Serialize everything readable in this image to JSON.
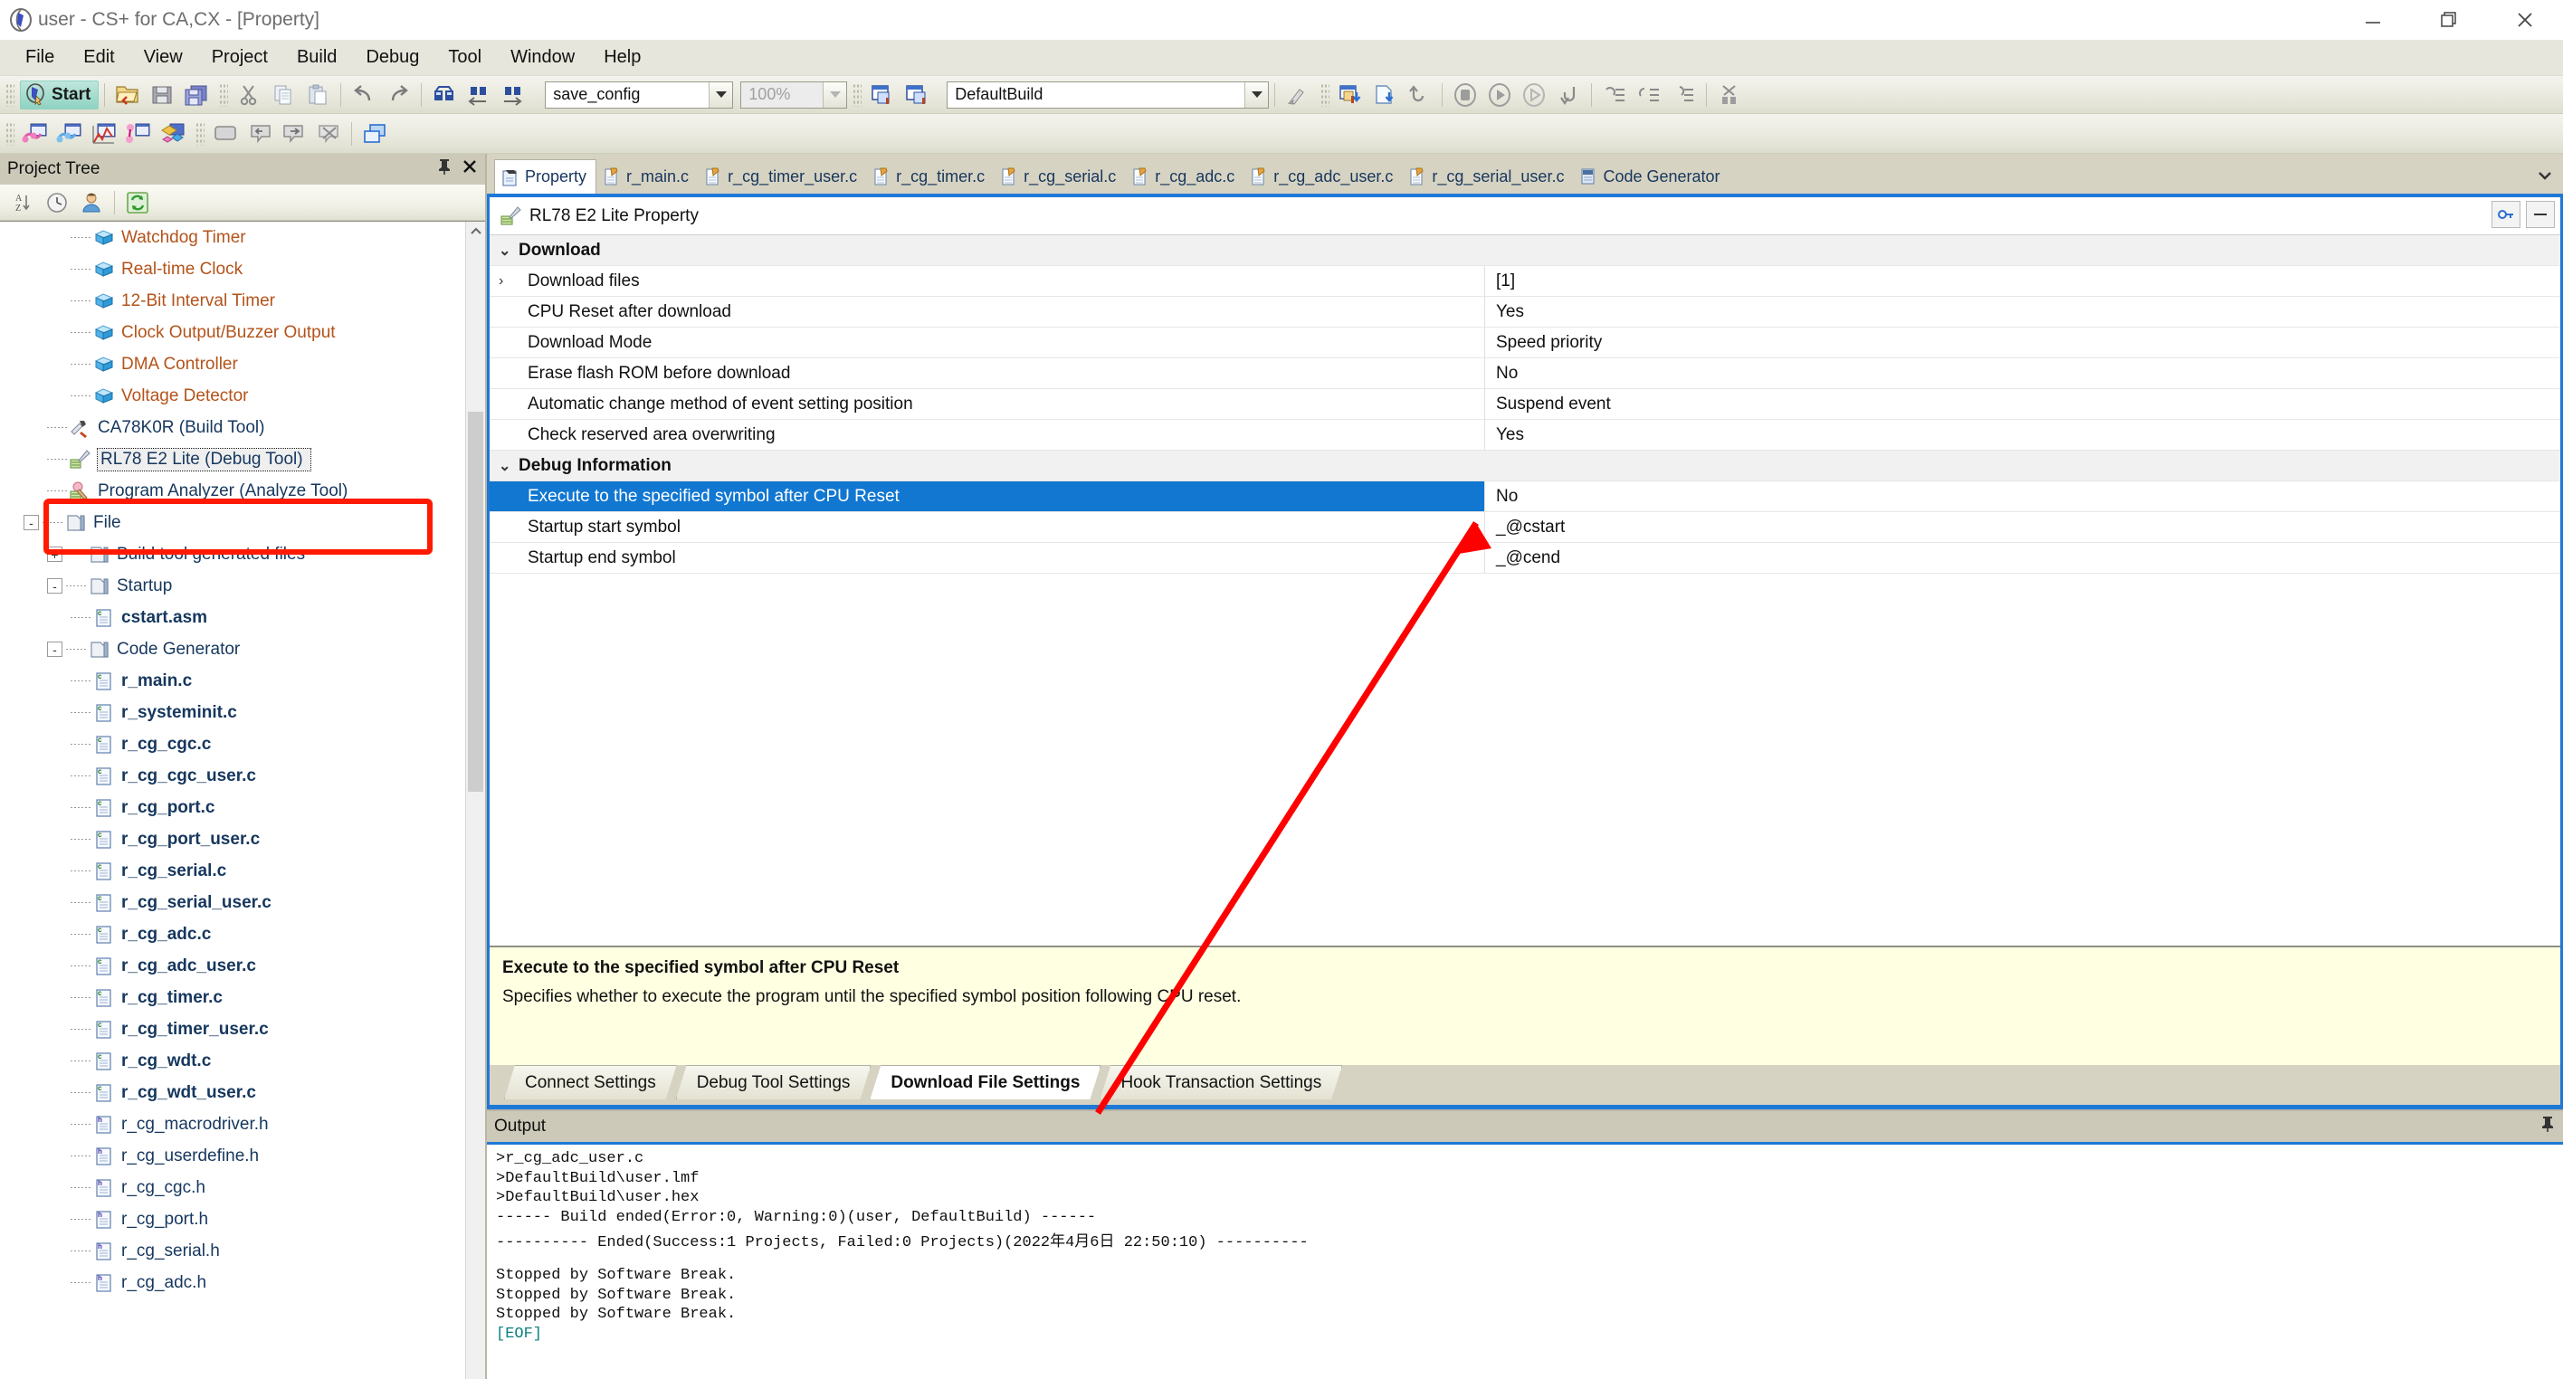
{
  "window": {
    "title": "user - CS+ for CA,CX - [Property]",
    "app_icon": "cs-plus-icon",
    "controls": {
      "minimize": "minimize-icon",
      "restore": "restore-icon",
      "close": "close-icon"
    }
  },
  "menubar": {
    "items": [
      "File",
      "Edit",
      "View",
      "Project",
      "Build",
      "Debug",
      "Tool",
      "Window",
      "Help"
    ]
  },
  "toolbar": {
    "start_label": "Start",
    "build_config": "save_config",
    "zoom_level": "100%",
    "build_mode": "DefaultBuild",
    "icons": [
      "open-folder-icon",
      "save-icon",
      "save-all-icon",
      "cut-icon",
      "copy-icon",
      "paste-icon",
      "undo-icon",
      "redo-icon",
      "find-in-files-icon",
      "find-previous-icon",
      "find-next-icon",
      "build-project-icon",
      "rebuild-project-icon",
      "clean-icon",
      "download-icon",
      "build-and-download-icon",
      "restart-icon",
      "stop-icon",
      "run-icon",
      "step-over-icon",
      "step-return-icon",
      "step-into-icon",
      "step-out-icon",
      "step-cursor-icon",
      "disconnect-icon"
    ],
    "row2_icons": [
      "cpu-register-icon",
      "memory-icon",
      "analyze-chart-icon",
      "pin-tool-icon",
      "event-icon",
      "rect-select-icon",
      "callout-left-icon",
      "callout-right-icon",
      "no-callout-icon",
      "cascade-windows-icon"
    ]
  },
  "project_tree": {
    "title": "Project Tree",
    "header_icons": [
      "pin-icon",
      "close-icon"
    ],
    "toolbar_icons": [
      "sort-az-icon",
      "history-icon",
      "user-icon",
      "refresh-icon"
    ],
    "nodes": [
      {
        "label": "Watchdog Timer",
        "icon": "peripheral-cube-icon",
        "depth": 3,
        "kind": "peripheral"
      },
      {
        "label": "Real-time Clock",
        "icon": "peripheral-cube-icon",
        "depth": 3,
        "kind": "peripheral"
      },
      {
        "label": "12-Bit Interval Timer",
        "icon": "peripheral-cube-icon",
        "depth": 3,
        "kind": "peripheral"
      },
      {
        "label": "Clock Output/Buzzer Output",
        "icon": "peripheral-cube-icon",
        "depth": 3,
        "kind": "peripheral"
      },
      {
        "label": "DMA Controller",
        "icon": "peripheral-cube-icon",
        "depth": 3,
        "kind": "peripheral"
      },
      {
        "label": "Voltage Detector",
        "icon": "peripheral-cube-icon",
        "depth": 3,
        "kind": "peripheral"
      },
      {
        "label": "CA78K0R (Build Tool)",
        "icon": "build-tool-icon",
        "depth": 2,
        "kind": "tool-blue"
      },
      {
        "label": "RL78 E2 Lite (Debug Tool)",
        "icon": "debug-tool-icon",
        "depth": 2,
        "kind": "tool-selected"
      },
      {
        "label": "Program Analyzer (Analyze Tool)",
        "icon": "analyze-tool-icon",
        "depth": 2,
        "kind": "tool"
      },
      {
        "label": "File",
        "icon": "folder-file-icon",
        "depth": 1,
        "kind": "folder",
        "expander": "-"
      },
      {
        "label": "Build tool generated files",
        "icon": "generated-folder-icon",
        "depth": 2,
        "kind": "folder",
        "expander": "+"
      },
      {
        "label": "Startup",
        "icon": "startup-folder-icon",
        "depth": 2,
        "kind": "folder",
        "expander": "-"
      },
      {
        "label": "cstart.asm",
        "icon": "asm-file-icon",
        "depth": 3,
        "kind": "file-bold"
      },
      {
        "label": "Code Generator",
        "icon": "folder-icon",
        "depth": 2,
        "kind": "folder",
        "expander": "-"
      },
      {
        "label": "r_main.c",
        "icon": "c-file-icon",
        "depth": 3,
        "kind": "file-bold"
      },
      {
        "label": "r_systeminit.c",
        "icon": "c-file-icon",
        "depth": 3,
        "kind": "file-bold"
      },
      {
        "label": "r_cg_cgc.c",
        "icon": "c-file-icon",
        "depth": 3,
        "kind": "file-bold"
      },
      {
        "label": "r_cg_cgc_user.c",
        "icon": "c-file-icon",
        "depth": 3,
        "kind": "file-bold"
      },
      {
        "label": "r_cg_port.c",
        "icon": "c-file-icon",
        "depth": 3,
        "kind": "file-bold"
      },
      {
        "label": "r_cg_port_user.c",
        "icon": "c-file-icon",
        "depth": 3,
        "kind": "file-bold"
      },
      {
        "label": "r_cg_serial.c",
        "icon": "c-file-icon",
        "depth": 3,
        "kind": "file-bold"
      },
      {
        "label": "r_cg_serial_user.c",
        "icon": "c-file-icon",
        "depth": 3,
        "kind": "file-bold"
      },
      {
        "label": "r_cg_adc.c",
        "icon": "c-file-icon",
        "depth": 3,
        "kind": "file-bold"
      },
      {
        "label": "r_cg_adc_user.c",
        "icon": "c-file-icon",
        "depth": 3,
        "kind": "file-bold"
      },
      {
        "label": "r_cg_timer.c",
        "icon": "c-file-icon",
        "depth": 3,
        "kind": "file-bold"
      },
      {
        "label": "r_cg_timer_user.c",
        "icon": "c-file-icon",
        "depth": 3,
        "kind": "file-bold"
      },
      {
        "label": "r_cg_wdt.c",
        "icon": "c-file-icon",
        "depth": 3,
        "kind": "file-bold"
      },
      {
        "label": "r_cg_wdt_user.c",
        "icon": "c-file-icon",
        "depth": 3,
        "kind": "file-bold"
      },
      {
        "label": "r_cg_macrodriver.h",
        "icon": "h-file-icon",
        "depth": 3,
        "kind": "file"
      },
      {
        "label": "r_cg_userdefine.h",
        "icon": "h-file-icon",
        "depth": 3,
        "kind": "file"
      },
      {
        "label": "r_cg_cgc.h",
        "icon": "h-file-icon",
        "depth": 3,
        "kind": "file"
      },
      {
        "label": "r_cg_port.h",
        "icon": "h-file-icon",
        "depth": 3,
        "kind": "file"
      },
      {
        "label": "r_cg_serial.h",
        "icon": "h-file-icon",
        "depth": 3,
        "kind": "file"
      },
      {
        "label": "r_cg_adc.h",
        "icon": "h-file-icon",
        "depth": 3,
        "kind": "file"
      }
    ]
  },
  "editor_tabs": {
    "items": [
      {
        "label": "Property",
        "icon": "property-icon",
        "active": true
      },
      {
        "label": "r_main.c",
        "icon": "c-source-icon",
        "active": false
      },
      {
        "label": "r_cg_timer_user.c",
        "icon": "c-source-icon",
        "active": false
      },
      {
        "label": "r_cg_timer.c",
        "icon": "c-source-icon",
        "active": false
      },
      {
        "label": "r_cg_serial.c",
        "icon": "c-source-icon",
        "active": false
      },
      {
        "label": "r_cg_adc.c",
        "icon": "c-source-icon",
        "active": false
      },
      {
        "label": "r_cg_adc_user.c",
        "icon": "c-source-icon",
        "active": false
      },
      {
        "label": "r_cg_serial_user.c",
        "icon": "c-source-icon",
        "active": false
      },
      {
        "label": "Code Generator",
        "icon": "code-generator-icon",
        "active": false
      }
    ],
    "overflow_icon": "chevron-down-icon"
  },
  "property": {
    "header": {
      "title": "RL78 E2 Lite Property",
      "icon": "debug-tool-icon",
      "buttons": [
        "key-icon",
        "collapse-icon"
      ]
    },
    "rows": [
      {
        "type": "category",
        "name": "Download",
        "value": "",
        "chev": "v"
      },
      {
        "type": "row",
        "name": "Download files",
        "value": "[1]",
        "chev": ">"
      },
      {
        "type": "row",
        "name": "CPU Reset after download",
        "value": "Yes",
        "chev": ""
      },
      {
        "type": "row",
        "name": "Download Mode",
        "value": "Speed priority",
        "chev": ""
      },
      {
        "type": "row",
        "name": "Erase flash ROM before download",
        "value": "No",
        "chev": ""
      },
      {
        "type": "row",
        "name": "Automatic change method of event setting position",
        "value": "Suspend event",
        "chev": ""
      },
      {
        "type": "row",
        "name": "Check reserved area overwriting",
        "value": "Yes",
        "chev": ""
      },
      {
        "type": "category",
        "name": "Debug Information",
        "value": "",
        "chev": "v"
      },
      {
        "type": "row",
        "name": "Execute to the specified symbol after CPU Reset",
        "value": "No",
        "chev": "",
        "selected": true
      },
      {
        "type": "row",
        "name": "Startup start symbol",
        "value": "_@cstart",
        "chev": ""
      },
      {
        "type": "row",
        "name": "Startup end symbol",
        "value": "_@cend",
        "chev": ""
      }
    ],
    "description": {
      "title": "Execute to the specified symbol after CPU Reset",
      "text": "Specifies whether to execute the program until the specified symbol position following CPU reset."
    },
    "subtabs": [
      {
        "label": "Connect Settings",
        "active": false
      },
      {
        "label": "Debug Tool Settings",
        "active": false
      },
      {
        "label": "Download File Settings",
        "active": true
      },
      {
        "label": "Hook Transaction Settings",
        "active": false
      }
    ]
  },
  "output": {
    "title": "Output",
    "pin_icon": "pin-icon",
    "lines": [
      ">r_cg_adc_user.c",
      ">DefaultBuild\\user.lmf",
      ">DefaultBuild\\user.hex",
      "------ Build ended(Error:0, Warning:0)(user, DefaultBuild) ------",
      "---------- Ended(Success:1 Projects, Failed:0 Projects)(2022年4月6日 22:50:10) ----------",
      "",
      "Stopped by Software Break.",
      "Stopped by Software Break.",
      "Stopped by Software Break.",
      "[EOF]"
    ]
  },
  "annotations": {
    "highlight_color": "#ff1a00",
    "arrow_color": "#ff0000",
    "highlight_target": "RL78 E2 Lite (Debug Tool)",
    "arrow_from": "Download File Settings tab",
    "arrow_to": "Execute to the specified symbol after CPU Reset value"
  },
  "colors": {
    "selection_blue": "#1177d1",
    "panel_border_blue": "#1e78d7",
    "chrome": "#d6d3c2",
    "desc_background": "#ffffe1",
    "tree_text_orange": "#b4531a",
    "tree_text_blue": "#16375e"
  }
}
